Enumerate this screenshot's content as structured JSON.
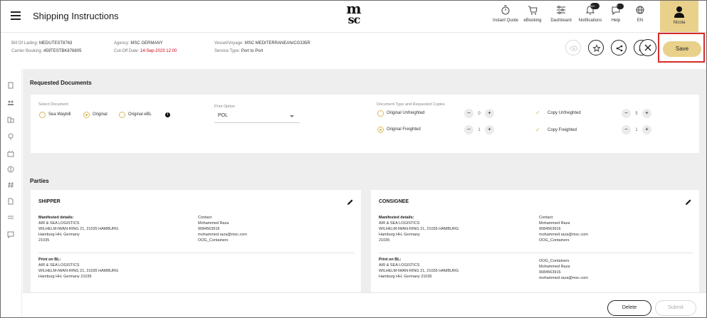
{
  "header": {
    "title": "Shipping Instructions",
    "logo_top": "m",
    "logo_bottom": "sc",
    "nav": [
      {
        "label": "Instant Quote",
        "icon": "stopwatch-icon"
      },
      {
        "label": "eBooking",
        "icon": "cart-icon"
      },
      {
        "label": "Dashboard",
        "icon": "sliders-icon"
      },
      {
        "label": "Notifications",
        "icon": "bell-icon",
        "badge": "99+"
      },
      {
        "label": "Help",
        "icon": "chat-help-icon",
        "badge": "?"
      },
      {
        "label": "EN",
        "icon": "globe-icon"
      }
    ],
    "user": {
      "name": "Nicola",
      "icon": "user-icon"
    }
  },
  "shipment": {
    "bill_of_lading_label": "Bill Of Lading:",
    "bill_of_lading": "MEDUTEST8763",
    "carrier_booking_label": "Carrier Booking:",
    "carrier_booking": "459TESTBK876805",
    "agency_label": "Agency:",
    "agency": "MSC GERMANY",
    "cutoff_label": "Cut-Off Date:",
    "cutoff": "14-Sep-2023 12:00",
    "vessel_label": "Vessel/Voyage:",
    "vessel": "MSC MEDITERRANEAN/CG335R",
    "service_label": "Service Type:",
    "service": "Port to Port"
  },
  "actions": {
    "save": "Save",
    "delete": "Delete",
    "submit": "Submit"
  },
  "requested_documents": {
    "title": "Requested Documents",
    "select_label": "Select Document",
    "options": [
      "Sea Waybill",
      "Original",
      "Original eBL"
    ],
    "selected": "Original",
    "print_label": "Print Option",
    "print_value": "POL",
    "type_label": "Document Type and Requested Copies",
    "rows": [
      {
        "label": "Original Unfreighted",
        "value": "0"
      },
      {
        "label": "Original Freighted",
        "value": "1"
      }
    ],
    "copies": [
      {
        "label": "Copy Unfreighted",
        "value": "5"
      },
      {
        "label": "Copy Freighted",
        "value": "1"
      }
    ]
  },
  "parties": {
    "title": "Parties",
    "shipper": {
      "title": "SHIPPER",
      "manifested_label": "Manifested details:",
      "manifested": [
        "AIR & SEA LOGISTICS",
        "WILHELM-IWAN-RING 21, 21035 HAMBURG",
        "Hamburg HH, Germany",
        "21035"
      ],
      "contact": [
        "Contact:",
        "Mohammed Raza",
        "9084563916",
        "mohammed.raza@msc.com",
        "OOG_Containers"
      ],
      "print_label": "Print on BL:",
      "print": [
        "AIR & SEA LOGISTICS",
        "WILHELM-IWAN-RING 21, 21035 HAMBURG",
        "Hamburg HH, Germany 21035"
      ]
    },
    "consignee": {
      "title": "CONSIGNEE",
      "manifested_label": "Manifested details:",
      "manifested": [
        "AIR & SEA LOGISTICS",
        "WILHELM-IWAN-RING 21, 21035 HAMBURG",
        "Hamburg HH, Germany",
        "21035"
      ],
      "contact": [
        "Contact:",
        "Mohammed Raza",
        "9084563916",
        "mohammed.raza@msc.com",
        "OOG_Containers"
      ],
      "print_label": "Print on BL:",
      "print": [
        "AIR & SEA LOGISTICS",
        "WILHELM-IWAN-RING 21, 21035 HAMBURG",
        "Hamburg HH, Germany 21035"
      ],
      "print_contact": [
        "OOG_Containers",
        "Mohammed Raza",
        "9084563916",
        "mohammed.raza@msc.com"
      ]
    }
  },
  "colors": {
    "accent": "#e9d18b",
    "highlight": "#d62b2b",
    "cutoff": "#d0021b"
  }
}
